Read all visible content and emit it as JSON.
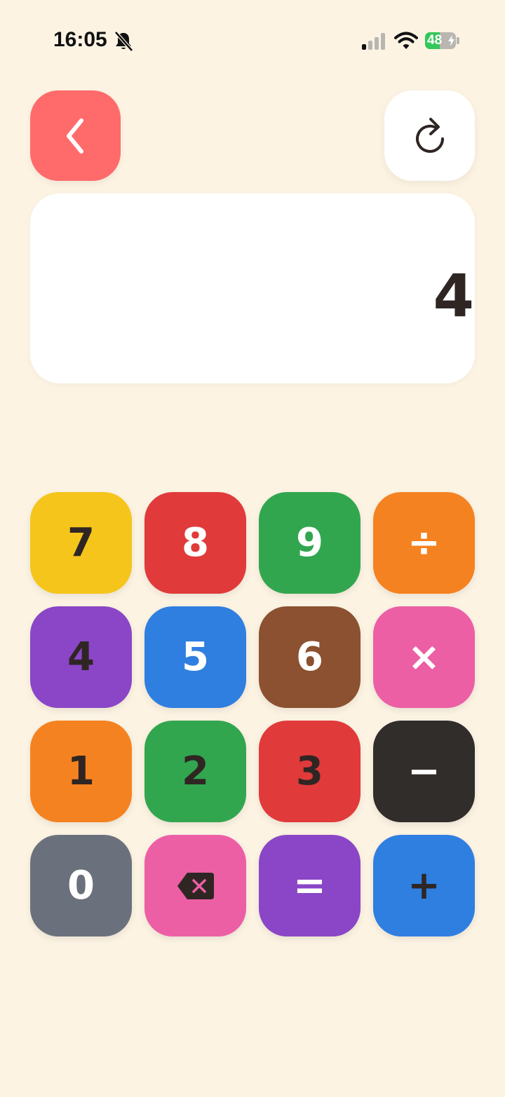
{
  "status_bar": {
    "time": "16:05",
    "battery_level": "48",
    "battery_fraction": 0.48,
    "icons": [
      "bell-muted-icon",
      "cellular-signal-icon",
      "wifi-icon",
      "battery-charging-icon"
    ]
  },
  "header": {
    "back_icon": "chevron-left-icon",
    "reset_icon": "refresh-icon"
  },
  "display": {
    "value": "4"
  },
  "keypad": {
    "keys": [
      {
        "label": "7",
        "bg": "#f5c51c",
        "fg": "#2f2624"
      },
      {
        "label": "8",
        "bg": "#e03a3a",
        "fg": "#ffffff"
      },
      {
        "label": "9",
        "bg": "#32a64f",
        "fg": "#ffffff"
      },
      {
        "label": "÷",
        "bg": "#f58220",
        "fg": "#ffffff"
      },
      {
        "label": "4",
        "bg": "#8a46c6",
        "fg": "#2f2624"
      },
      {
        "label": "5",
        "bg": "#2f7fe0",
        "fg": "#ffffff"
      },
      {
        "label": "6",
        "bg": "#8b5130",
        "fg": "#ffffff"
      },
      {
        "label": "×",
        "bg": "#ec5fa5",
        "fg": "#ffffff"
      },
      {
        "label": "1",
        "bg": "#f58220",
        "fg": "#2f2624"
      },
      {
        "label": "2",
        "bg": "#32a64f",
        "fg": "#2f2624"
      },
      {
        "label": "3",
        "bg": "#e03a3a",
        "fg": "#2f2624"
      },
      {
        "label": "−",
        "bg": "#302d2b",
        "fg": "#ffffff"
      },
      {
        "label": "0",
        "bg": "#6b717c",
        "fg": "#ffffff"
      },
      {
        "label": "",
        "icon": "backspace-icon",
        "bg": "#ec5fa5",
        "fg": "#2f2624"
      },
      {
        "label": "=",
        "bg": "#8a46c6",
        "fg": "#ffffff"
      },
      {
        "label": "+",
        "bg": "#2f7fe0",
        "fg": "#2f2624"
      }
    ]
  }
}
